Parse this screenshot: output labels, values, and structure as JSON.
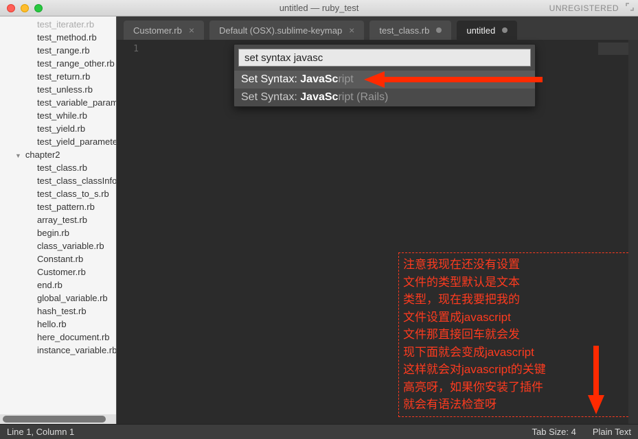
{
  "titlebar": {
    "title": "untitled — ruby_test",
    "unregistered": "UNREGISTERED"
  },
  "sidebar": {
    "files_top": [
      "test_iterater.rb",
      "test_method.rb",
      "test_range.rb",
      "test_range_other.rb",
      "test_return.rb",
      "test_unless.rb",
      "test_variable_parameter.rb",
      "test_while.rb",
      "test_yield.rb",
      "test_yield_parameter.rb"
    ],
    "folder": "chapter2",
    "files_folder": [
      "test_class.rb",
      "test_class_classInfo.rb",
      "test_class_to_s.rb",
      "test_pattern.rb",
      "array_test.rb",
      "begin.rb",
      "class_variable.rb",
      "Constant.rb",
      "Customer.rb",
      "end.rb",
      "global_variable.rb",
      "hash_test.rb",
      "hello.rb",
      "here_document.rb",
      "instance_variable.rb"
    ]
  },
  "tabs": [
    {
      "label": "Customer.rb",
      "kind": "close"
    },
    {
      "label": "Default (OSX).sublime-keymap",
      "kind": "close"
    },
    {
      "label": "test_class.rb",
      "kind": "dot"
    },
    {
      "label": "untitled",
      "kind": "dot",
      "active": true
    }
  ],
  "gutter": {
    "line1": "1"
  },
  "palette": {
    "input_value": "set syntax javasc",
    "items": [
      {
        "prefix": "Set Syntax",
        "bold": "JavaSc",
        "rest": "ript",
        "selected": true
      },
      {
        "prefix": "Set Syntax",
        "bold": "JavaSc",
        "rest": "ript (Rails)",
        "selected": false
      }
    ]
  },
  "annotation": {
    "lines": [
      "注意我现在还没有设置",
      "文件的类型默认是文本",
      "类型，现在我要把我的",
      "文件设置成javascript",
      "文件那直接回车就会发",
      "现下面就会变成javascript",
      "这样就会对javascript的关键",
      "高亮呀，如果你安装了插件",
      "就会有语法检查呀"
    ]
  },
  "statusbar": {
    "position": "Line 1, Column 1",
    "tabsize": "Tab Size: 4",
    "syntax": "Plain Text"
  }
}
